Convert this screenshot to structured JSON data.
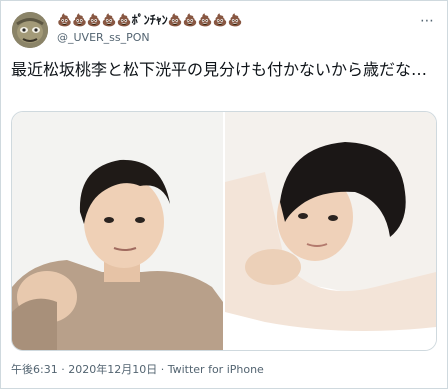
{
  "author": {
    "display_name": "💩💩💩💩💩ﾎﾟﾝﾁｬﾝ💩💩💩💩💩",
    "handle": "@_UVER_ss_PON"
  },
  "tweet": {
    "text": "最近松坂桃李と松下洸平の見分けも付かないから歳だな…"
  },
  "media": {
    "photo_left": "photo-left",
    "photo_right": "photo-right"
  },
  "meta": {
    "time": "午後6:31",
    "sep1": " · ",
    "date": "2020年12月10日",
    "sep2": " · ",
    "source": "Twitter for iPhone"
  },
  "icons": {
    "more": "more-options-icon"
  }
}
